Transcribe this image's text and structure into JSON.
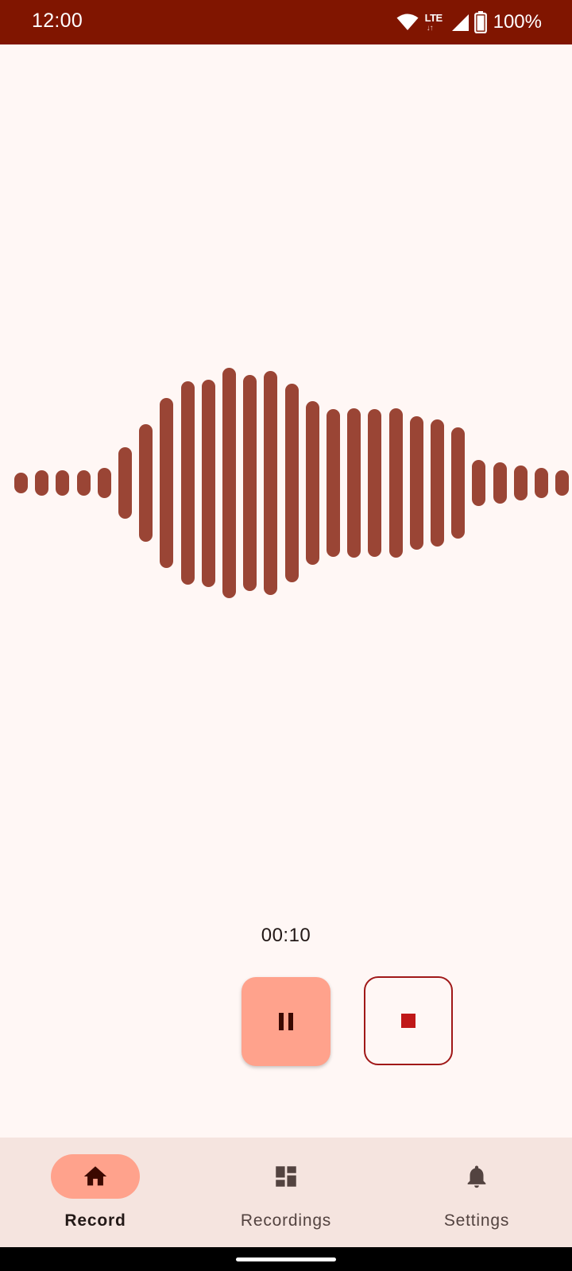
{
  "status_bar": {
    "time": "12:00",
    "network_label": "LTE",
    "battery_percent": "100%"
  },
  "waveform": {
    "levels": [
      0.09,
      0.11,
      0.11,
      0.11,
      0.13,
      0.31,
      0.51,
      0.74,
      0.88,
      0.9,
      1.0,
      0.94,
      0.97,
      0.86,
      0.71,
      0.64,
      0.65,
      0.64,
      0.65,
      0.58,
      0.55,
      0.48,
      0.2,
      0.18,
      0.15,
      0.13,
      0.11
    ],
    "color": "#9a4535"
  },
  "recorder": {
    "elapsed": "00:10",
    "pause_icon": "pause-icon",
    "stop_icon": "stop-icon"
  },
  "navigation": {
    "items": [
      {
        "label": "Record",
        "icon": "home-icon",
        "active": true
      },
      {
        "label": "Recordings",
        "icon": "dashboard-icon",
        "active": false
      },
      {
        "label": "Settings",
        "icon": "bell-icon",
        "active": false
      }
    ]
  },
  "colors": {
    "status_bar": "#801500",
    "background": "#fff7f5",
    "accent_container": "#ffa28c",
    "stop_red": "#c01818",
    "nav_background": "#f5e4df"
  }
}
